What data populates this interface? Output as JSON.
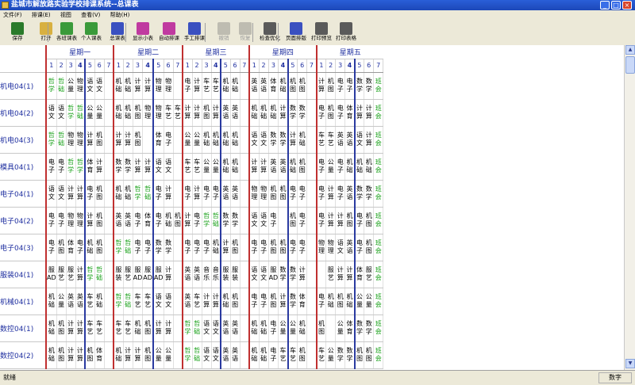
{
  "window": {
    "title": "盐城市解放路实验学校排课系统--总课表"
  },
  "menu": [
    "文件(F)",
    "排课(E)",
    "视图",
    "查看(V)",
    "帮助(H)"
  ],
  "toolbar": [
    {
      "label": "保存",
      "icon": "save-icon",
      "color": "#2a7a2a",
      "disabled": false
    },
    {
      "label": "打开",
      "icon": "folder-open-icon",
      "color": "#d8b040",
      "disabled": false
    },
    {
      "label": "各班课表",
      "icon": "class-timetable-icon",
      "color": "#3a9a3a",
      "disabled": false
    },
    {
      "label": "个人课表",
      "icon": "personal-timetable-icon",
      "color": "#3a9a3a",
      "disabled": false
    },
    {
      "label": "总课表",
      "icon": "master-timetable-icon",
      "color": "#3a50c0",
      "disabled": false
    },
    {
      "label": "显示小表",
      "icon": "small-table-icon",
      "color": "#c03aa0",
      "disabled": false
    },
    {
      "label": "自动排课",
      "icon": "auto-schedule-icon",
      "color": "#c03aa0",
      "disabled": false
    },
    {
      "label": "手工排课",
      "icon": "hand-schedule-icon",
      "color": "#3a50c0",
      "disabled": false
    },
    {
      "label": "撤销",
      "icon": "undo-icon",
      "color": "#6a6a6a",
      "disabled": true
    },
    {
      "label": "恢复",
      "icon": "redo-icon",
      "color": "#6a6a6a",
      "disabled": true
    },
    {
      "label": "检查优化",
      "icon": "check-optimize-icon",
      "color": "#5a5a5a",
      "disabled": false
    },
    {
      "label": "页面排版",
      "icon": "page-layout-icon",
      "color": "#3a50c0",
      "disabled": false
    },
    {
      "label": "打印预览",
      "icon": "print-preview-icon",
      "color": "#5a5a5a",
      "disabled": false
    },
    {
      "label": "打印表格",
      "icon": "print-icon",
      "color": "#5a5a5a",
      "disabled": false
    }
  ],
  "schedule": {
    "days": [
      "星期一",
      "星期二",
      "星期三",
      "星期四",
      "星期五"
    ],
    "periods": [
      "1",
      "2",
      "3",
      "4",
      "5",
      "6",
      "7"
    ],
    "green_subjects": [
      "哲学",
      "班会",
      "哲础"
    ],
    "rows": [
      {
        "class": "机电04(1)",
        "cells": [
          "哲学",
          "哲础",
          "公量",
          "物理",
          "语文",
          "语文",
          "",
          "机础",
          "机础",
          "计算",
          "计算",
          "物理",
          "物理",
          "",
          "电子",
          "计算",
          "车艺",
          "车艺",
          "机础",
          "机础",
          "",
          "英语",
          "英语",
          "体育",
          "机础",
          "机图",
          "机图",
          "",
          "计算",
          "机图",
          "电子",
          "电子",
          "数学",
          "数学",
          "班会"
        ]
      },
      {
        "class": "机电04(2)",
        "cells": [
          "语文",
          "语文",
          "哲学",
          "哲础",
          "公量",
          "公量",
          "",
          "机础",
          "机础",
          "机图",
          "物理",
          "物理",
          "车艺",
          "车艺",
          "计算",
          "计算",
          "机图",
          "计算",
          "英语",
          "英语",
          "",
          "机础",
          "机础",
          "机础",
          "计算",
          "数学",
          "数学",
          "",
          "电子",
          "机图",
          "电子",
          "体育",
          "计算",
          "计算",
          "班会"
        ]
      },
      {
        "class": "机电04(3)",
        "cells": [
          "哲学",
          "哲础",
          "物理",
          "物理",
          "计算",
          "机图",
          "",
          "计算",
          "计算",
          "机图",
          "",
          "体育",
          "电子",
          "",
          "公量",
          "公量",
          "机础",
          "机础",
          "机础",
          "机础",
          "",
          "语文",
          "语文",
          "数学",
          "数学",
          "计算",
          "机础",
          "",
          "车艺",
          "车艺",
          "英语",
          "英语",
          "语文",
          "计算",
          "班会"
        ]
      },
      {
        "class": "模具04(1)",
        "cells": [
          "电子",
          "电子",
          "哲学",
          "哲学",
          "体育",
          "计算",
          "",
          "数学",
          "数学",
          "计算",
          "计算",
          "语文",
          "语文",
          "",
          "车艺",
          "车艺",
          "公量",
          "公量",
          "机础",
          "机础",
          "",
          "计算",
          "计算",
          "英语",
          "英语",
          "机础",
          "机图",
          "",
          "电子",
          "公量",
          "电子",
          "机础",
          "机础",
          "机础",
          "班会"
        ]
      },
      {
        "class": "电子04(1)",
        "cells": [
          "语文",
          "语文",
          "计算",
          "计算",
          "电子",
          "机图",
          "",
          "机础",
          "机础",
          "哲学",
          "哲础",
          "电子",
          "计算",
          "",
          "电子",
          "计算",
          "电子",
          "电子",
          "英语",
          "英语",
          "",
          "物理",
          "物理",
          "机图",
          "机图",
          "电子",
          "电子",
          "",
          "电子",
          "计算",
          "电子",
          "英语",
          "数学",
          "数学",
          "班会"
        ]
      },
      {
        "class": "电子04(2)",
        "cells": [
          "电子",
          "电子",
          "物理",
          "物理",
          "计算",
          "机图",
          "",
          "英语",
          "英语",
          "电子",
          "体育",
          "电子",
          "机础",
          "机图",
          "计算",
          "电子",
          "哲学",
          "哲础",
          "数学",
          "数学",
          "",
          "语文",
          "语文",
          "电子",
          "",
          "机图",
          "电子",
          "",
          "电子",
          "计算",
          "计算",
          "机图",
          "电子",
          "机图",
          "班会"
        ]
      },
      {
        "class": "电子04(3)",
        "cells": [
          "电子",
          "机图",
          "体育",
          "电子",
          "机础",
          "机图",
          "",
          "哲学",
          "哲础",
          "电子",
          "电子",
          "数学",
          "数学",
          "",
          "电子",
          "电子",
          "电子",
          "机础",
          "计算",
          "机图",
          "",
          "电子",
          "电子",
          "机图",
          "机图",
          "电子",
          "电子",
          "",
          "物理",
          "物理",
          "语文",
          "英语",
          "电子",
          "机图",
          "班会"
        ]
      },
      {
        "class": "服装04(1)",
        "cells": [
          "服AD",
          "服艺",
          "服艺",
          "计算",
          "哲学",
          "哲础",
          "",
          "服装",
          "服艺",
          "服AD",
          "服AD",
          "服AD",
          "计算",
          "",
          "英语",
          "英语",
          "音乐",
          "音乐",
          "服装",
          "服装",
          "",
          "语文",
          "语文",
          "服AD",
          "数学",
          "数学",
          "计算",
          "",
          "",
          "服艺",
          "计算",
          "计算",
          "体育",
          "服艺",
          "班会"
        ]
      },
      {
        "class": "机械04(1)",
        "cells": [
          "机础",
          "公量",
          "英语",
          "英语",
          "车艺",
          "机础",
          "",
          "哲学",
          "哲础",
          "车艺",
          "车艺",
          "语文",
          "语文",
          "",
          "英语",
          "车艺",
          "计算",
          "计算",
          "机础",
          "机图",
          "",
          "电子",
          "电子",
          "机图",
          "计算",
          "数学",
          "体育",
          "",
          "电子",
          "机础",
          "机图",
          "机础",
          "公量",
          "公量",
          "班会"
        ]
      },
      {
        "class": "数控04(1)",
        "cells": [
          "机础",
          "机图",
          "计算",
          "计算",
          "车艺",
          "车艺",
          "",
          "车艺",
          "车艺",
          "机础",
          "机图",
          "计算",
          "计算",
          "",
          "哲学",
          "哲础",
          "语文",
          "语文",
          "英语",
          "英语",
          "",
          "机础",
          "机础",
          "电子",
          "公量",
          "公量",
          "机础",
          "",
          "机图",
          "",
          "公量",
          "体育",
          "数学",
          "数学",
          "班会"
        ]
      },
      {
        "class": "数控04(2)",
        "cells": [
          "机础",
          "机图",
          "计算",
          "计算",
          "机图",
          "体育",
          "",
          "机础",
          "计算",
          "计算",
          "机图",
          "公量",
          "公量",
          "",
          "哲学",
          "哲础",
          "语文",
          "语文",
          "英语",
          "英语",
          "",
          "机础",
          "机础",
          "电子",
          "车艺",
          "车艺",
          "机图",
          "",
          "车艺",
          "公量",
          "数学",
          "数学",
          "机图",
          "机图",
          "班会"
        ]
      }
    ]
  },
  "status": {
    "text": "就绪",
    "mode": "数字"
  }
}
